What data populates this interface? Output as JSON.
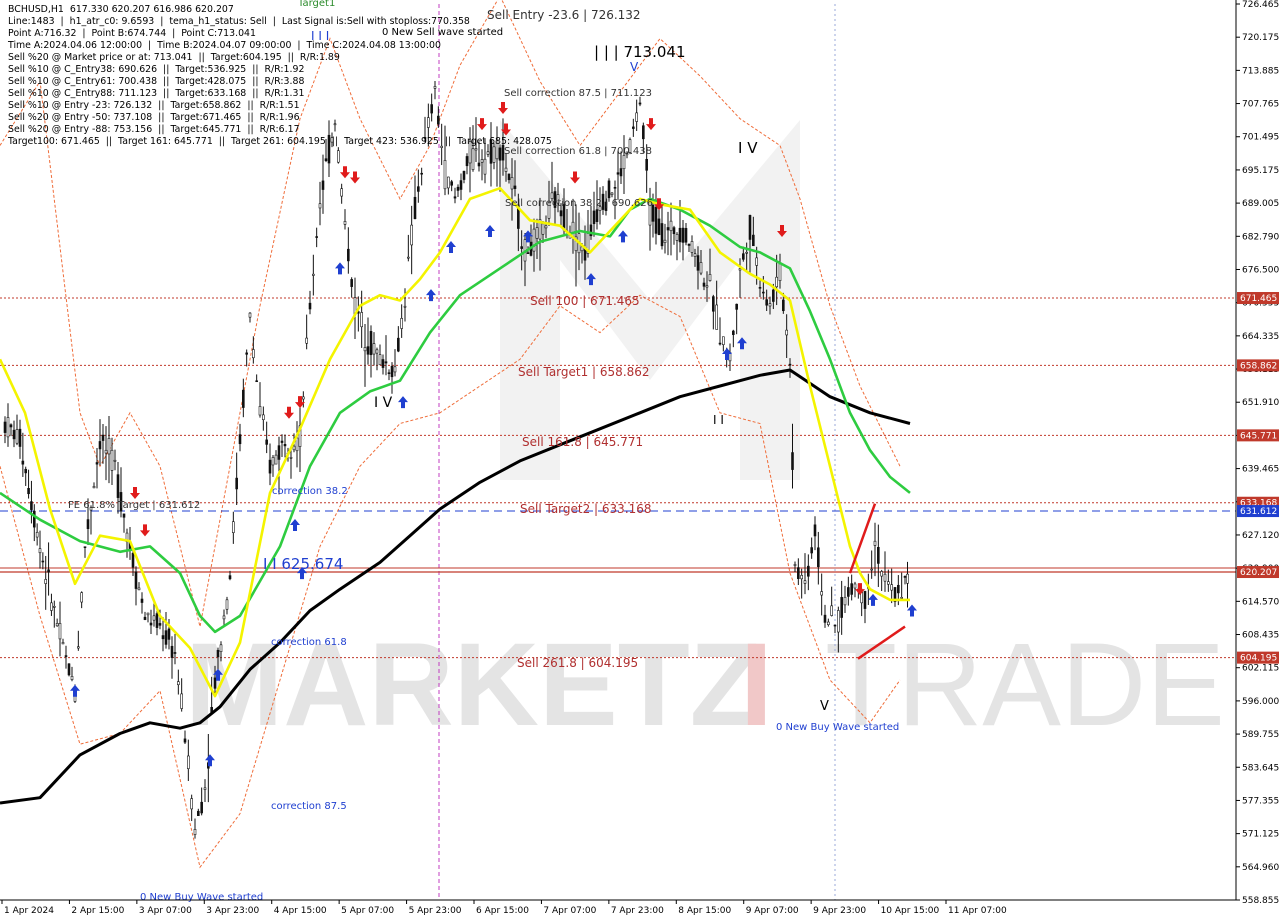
{
  "info_lines": [
    "BCHUSD,H1  617.330 620.207 616.986 620.207",
    "Line:1483  |  h1_atr_c0: 9.6593  |  tema_h1_status: Sell  |  Last Signal is:Sell with stoploss:770.358",
    "Point A:716.32  |  Point B:674.744  |  Point C:713.041",
    "Time A:2024.04.06 12:00:00  |  Time B:2024.04.07 09:00:00  |  Time C:2024.04.08 13:00:00",
    "Sell %20 @ Market price or at: 713.041  ||  Target:604.195  ||  R/R:1.89",
    "Sell %10 @ C_Entry38: 690.626  ||  Target:536.925  ||  R/R:1.92",
    "Sell %10 @ C_Entry61: 700.438  ||  Target:428.075  ||  R/R:3.88",
    "Sell %10 @ C_Entry88: 711.123  ||  Target:633.168  ||  R/R:1.31",
    "Sell %10 @ Entry -23: 726.132  ||  Target:658.862  ||  R/R:1.51",
    "Sell %20 @ Entry -50: 737.108  ||  Target:671.465  ||  R/R:1.96",
    "Sell %20 @ Entry -88: 753.156  ||  Target:645.771  ||  R/R:6.17",
    "Target100: 671.465  ||  Target 161: 645.771  ||  Target 261: 604.195  ||  Target 423: 536.925  ||  Target 685: 428.075"
  ],
  "watermark": {
    "text": "MARKETZITRADE",
    "left": "MARKETZ",
    "mid": "I",
    "right": "TRADE"
  },
  "chart_data": {
    "type": "line",
    "symbol": "BCHUSD",
    "timeframe": "H1",
    "ohlc_last": {
      "open": 617.33,
      "high": 620.207,
      "low": 616.986,
      "close": 620.207
    },
    "ylim": [
      558.855,
      726.465
    ],
    "y_ticks": [
      "726.465",
      "720.175",
      "713.885",
      "707.765",
      "701.495",
      "695.175",
      "689.005",
      "682.790",
      "676.500",
      "670.555",
      "664.335",
      "658.115",
      "651.910",
      "645.690",
      "639.465",
      "633.245",
      "627.120",
      "620.900",
      "614.570",
      "608.435",
      "602.115",
      "596.000",
      "589.755",
      "583.645",
      "577.355",
      "571.125",
      "564.960",
      "558.855"
    ],
    "x_ticks": [
      "1 Apr 2024",
      "2 Apr 15:00",
      "3 Apr 07:00",
      "3 Apr 23:00",
      "4 Apr 15:00",
      "5 Apr 07:00",
      "5 Apr 23:00",
      "6 Apr 15:00",
      "7 Apr 07:00",
      "7 Apr 23:00",
      "8 Apr 15:00",
      "9 Apr 07:00",
      "9 Apr 23:00",
      "10 Apr 15:00",
      "11 Apr 07:00"
    ],
    "levels": [
      {
        "label": "Sell 100 | 671.465",
        "value": 671.465,
        "tag": "671.465",
        "color": "#c0392b",
        "style": "dotted"
      },
      {
        "label": "Sell Target1 | 658.862",
        "value": 658.862,
        "tag": "658.862",
        "color": "#c0392b",
        "style": "dotted"
      },
      {
        "label": "Sell 161.8 | 645.771",
        "value": 645.771,
        "tag": "645.771",
        "color": "#c0392b",
        "style": "dotted"
      },
      {
        "label": "Sell Target2 | 633.168",
        "value": 633.168,
        "tag": "633.168",
        "color": "#c0392b",
        "style": "dotted"
      },
      {
        "label": "Sell 261.8 | 604.195",
        "value": 604.195,
        "tag": "604.195",
        "color": "#c0392b",
        "style": "dotted"
      },
      {
        "label": "",
        "value": 631.612,
        "tag": "631.612",
        "color": "#1f3fd0",
        "style": "dashed"
      },
      {
        "label": "",
        "value": 620.207,
        "tag": "620.207",
        "color": "#c0392b",
        "style": "solid"
      }
    ],
    "annotations": [
      {
        "text": "Sell Entry -23.6 | 726.132",
        "color": "#333333"
      },
      {
        "text": "| | | 713.041",
        "color": "#000000"
      },
      {
        "text": "Sell correction 87.5 | 711.123",
        "color": "#333333"
      },
      {
        "text": "Sell correction 61.8 | 700.438",
        "color": "#333333"
      },
      {
        "text": "Sell correction 38.2 | 690.626",
        "color": "#333333"
      },
      {
        "text": "0 New Sell wave started",
        "color": "#000000"
      },
      {
        "text": "I V",
        "color": "#000000"
      },
      {
        "text": "I V",
        "color": "#000000"
      },
      {
        "text": "I I",
        "color": "#000000"
      },
      {
        "text": "I I I",
        "color": "#1f3fd0"
      },
      {
        "text": "Target1",
        "color": "#2a8a2a"
      },
      {
        "text": "FE 61.8% Target | 631.612",
        "color": "#333333"
      },
      {
        "text": "correction 38.2",
        "color": "#1f3fd0"
      },
      {
        "text": "I I 625.674",
        "color": "#1f3fd0"
      },
      {
        "text": "correction 61.8",
        "color": "#1f3fd0"
      },
      {
        "text": "correction 87.5",
        "color": "#1f3fd0"
      },
      {
        "text": "0 New Buy Wave started",
        "color": "#1f3fd0"
      },
      {
        "text": "0 New Buy Wave started",
        "color": "#1f3fd0"
      },
      {
        "text": "V",
        "color": "#000000"
      },
      {
        "text": "V",
        "color": "#1f3fd0"
      }
    ],
    "series": [
      {
        "name": "",
        "color": "#000000",
        "points": [
          [
            0,
            577
          ],
          [
            40,
            578
          ],
          [
            80,
            586
          ],
          [
            120,
            590
          ],
          [
            150,
            592
          ],
          [
            180,
            591
          ],
          [
            200,
            592
          ],
          [
            220,
            595
          ],
          [
            250,
            602
          ],
          [
            280,
            607
          ],
          [
            310,
            613
          ],
          [
            340,
            617
          ],
          [
            380,
            622
          ],
          [
            410,
            627
          ],
          [
            440,
            632
          ],
          [
            480,
            637
          ],
          [
            520,
            641
          ],
          [
            560,
            644
          ],
          [
            600,
            647
          ],
          [
            640,
            650
          ],
          [
            680,
            653
          ],
          [
            720,
            655
          ],
          [
            760,
            657
          ],
          [
            790,
            658
          ],
          [
            830,
            653
          ],
          [
            870,
            650
          ],
          [
            910,
            648
          ]
        ]
      },
      {
        "name": "",
        "color": "#2ecc40",
        "points": [
          [
            0,
            635
          ],
          [
            40,
            630
          ],
          [
            80,
            626
          ],
          [
            120,
            624
          ],
          [
            150,
            625
          ],
          [
            180,
            620
          ],
          [
            200,
            612
          ],
          [
            215,
            609
          ],
          [
            240,
            612
          ],
          [
            280,
            625
          ],
          [
            310,
            640
          ],
          [
            340,
            650
          ],
          [
            370,
            654
          ],
          [
            400,
            656
          ],
          [
            430,
            665
          ],
          [
            460,
            672
          ],
          [
            500,
            677
          ],
          [
            540,
            682
          ],
          [
            580,
            684
          ],
          [
            610,
            683
          ],
          [
            630,
            688
          ],
          [
            650,
            690
          ],
          [
            680,
            688
          ],
          [
            710,
            685
          ],
          [
            740,
            681
          ],
          [
            760,
            680
          ],
          [
            790,
            677
          ],
          [
            810,
            669
          ],
          [
            830,
            660
          ],
          [
            850,
            650
          ],
          [
            870,
            643
          ],
          [
            890,
            638
          ],
          [
            910,
            635
          ]
        ]
      },
      {
        "name": "",
        "color": "#f4f400",
        "points": [
          [
            0,
            660
          ],
          [
            25,
            650
          ],
          [
            50,
            632
          ],
          [
            75,
            618
          ],
          [
            100,
            627
          ],
          [
            130,
            626
          ],
          [
            160,
            612
          ],
          [
            190,
            606
          ],
          [
            215,
            597
          ],
          [
            240,
            607
          ],
          [
            270,
            635
          ],
          [
            300,
            647
          ],
          [
            330,
            660
          ],
          [
            360,
            670
          ],
          [
            380,
            672
          ],
          [
            400,
            671
          ],
          [
            420,
            675
          ],
          [
            440,
            680
          ],
          [
            470,
            690
          ],
          [
            500,
            692
          ],
          [
            530,
            686
          ],
          [
            560,
            685
          ],
          [
            590,
            680
          ],
          [
            610,
            684
          ],
          [
            640,
            690
          ],
          [
            660,
            689
          ],
          [
            690,
            688
          ],
          [
            720,
            680
          ],
          [
            750,
            676
          ],
          [
            770,
            674
          ],
          [
            790,
            671
          ],
          [
            810,
            655
          ],
          [
            830,
            640
          ],
          [
            850,
            625
          ],
          [
            860,
            620
          ],
          [
            870,
            617
          ],
          [
            890,
            615
          ],
          [
            910,
            615
          ]
        ]
      }
    ],
    "series_candles_note": "price bars rendered as black wicks/bodies"
  }
}
